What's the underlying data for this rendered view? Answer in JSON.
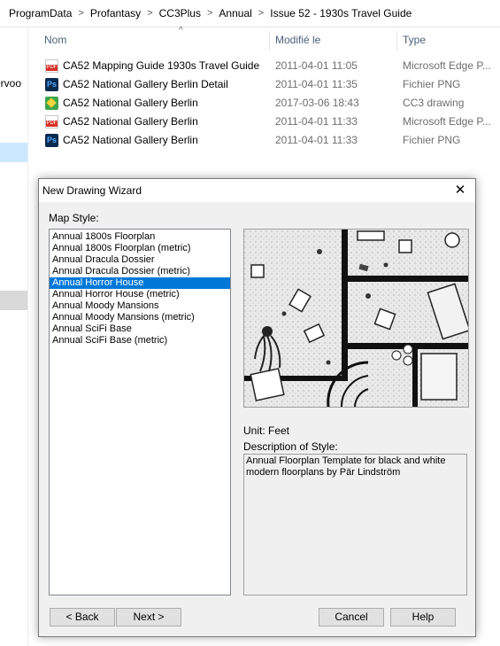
{
  "breadcrumb": [
    "ProgramData",
    "Profantasy",
    "CC3Plus",
    "Annual",
    "Issue 52 - 1930s Travel Guide"
  ],
  "nav_fragment": "ervoo",
  "columns": {
    "name": "Nom",
    "modified": "Modifié le",
    "type": "Type"
  },
  "files": [
    {
      "name": "CA52 Mapping Guide 1930s Travel Guide",
      "date": "2011-04-01 11:05",
      "type": "Microsoft Edge P...",
      "icon": "pdf-icon"
    },
    {
      "name": "CA52 National Gallery Berlin Detail",
      "date": "2011-04-01 11:35",
      "type": "Fichier PNG",
      "icon": "photoshop-icon"
    },
    {
      "name": "CA52 National Gallery Berlin",
      "date": "2017-03-06 18:43",
      "type": "CC3 drawing",
      "icon": "cc3-icon"
    },
    {
      "name": "CA52 National Gallery Berlin",
      "date": "2011-04-01 11:33",
      "type": "Microsoft Edge P...",
      "icon": "pdf-icon"
    },
    {
      "name": "CA52 National Gallery Berlin",
      "date": "2011-04-01 11:33",
      "type": "Fichier PNG",
      "icon": "photoshop-icon"
    }
  ],
  "dialog": {
    "title": "New Drawing Wizard",
    "close_glyph": "✕",
    "map_style_label": "Map Style:",
    "styles": [
      "Annual 1800s Floorplan",
      "Annual 1800s Floorplan (metric)",
      "Annual Dracula Dossier",
      "Annual Dracula Dossier (metric)",
      "Annual Horror House",
      "Annual Horror House (metric)",
      "Annual Moody Mansions",
      "Annual Moody Mansions (metric)",
      "Annual SciFi Base",
      "Annual SciFi Base (metric)"
    ],
    "selected_style": "Annual Horror House",
    "unit_label": "Unit: Feet",
    "description_label": "Description of Style:",
    "description": "Annual Floorplan Template for black and white modern floorplans by Pär Lindström",
    "buttons": {
      "back": "< Back",
      "next": "Next >",
      "cancel": "Cancel",
      "help": "Help"
    }
  },
  "colors": {
    "selection": "#0078d7",
    "dialog_bg": "#f0f0f0",
    "nav_selection": "#cce8ff"
  }
}
